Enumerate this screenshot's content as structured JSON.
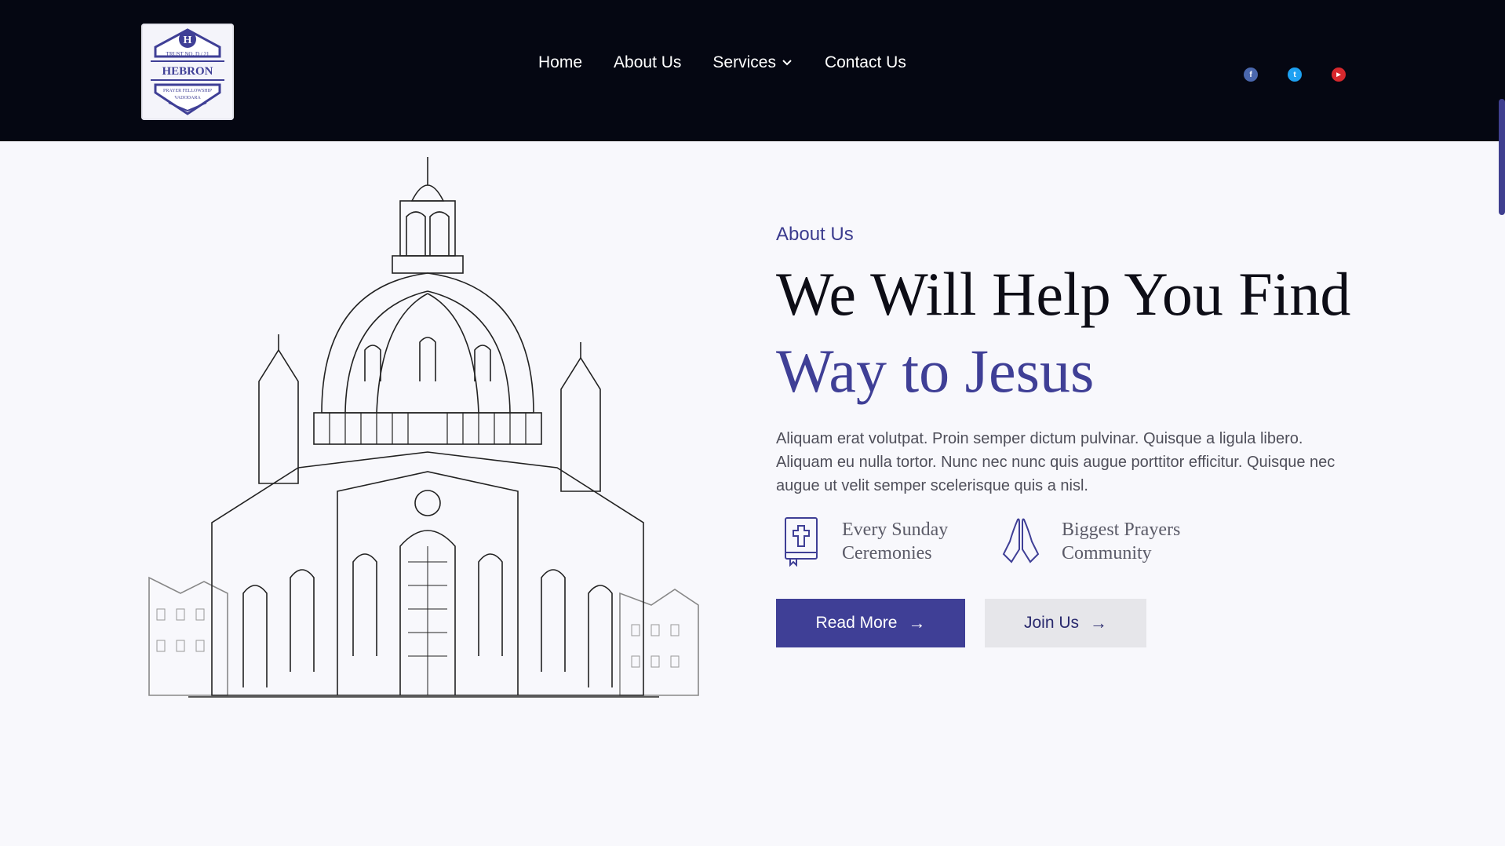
{
  "header": {
    "logo": {
      "letter": "H",
      "trust": "TRUST NO. D / 21",
      "name": "HEBRON",
      "tagline": "PRAYER FELLOWSHIP",
      "city": "VADODARA"
    },
    "nav": [
      {
        "label": "Home"
      },
      {
        "label": "About Us"
      },
      {
        "label": "Services",
        "has_dropdown": true
      },
      {
        "label": "Contact Us"
      }
    ],
    "social": [
      {
        "icon": "facebook-icon",
        "glyph": "f",
        "color": "#4a67ad"
      },
      {
        "icon": "twitter-icon",
        "glyph": "t",
        "color": "#1da1f2"
      },
      {
        "icon": "youtube-icon",
        "glyph": "▶",
        "color": "#d7282d"
      }
    ]
  },
  "about": {
    "eyebrow": "About Us",
    "headline_line1": "We Will Help You Find",
    "headline_line2": "Way to Jesus",
    "body": "Aliquam erat volutpat. Proin semper dictum pulvinar. Quisque a ligula libero. Aliquam eu nulla tortor. Nunc nec nunc quis augue porttitor efficitur. Quisque nec augue ut velit semper scelerisque quis a nisl.",
    "features": [
      {
        "icon": "bible-icon",
        "label": "Every Sunday Ceremonies"
      },
      {
        "icon": "praying-hands-icon",
        "label": "Biggest Prayers Community"
      }
    ],
    "buttons": {
      "primary": "Read More",
      "secondary": "Join Us"
    }
  },
  "colors": {
    "header_bg": "#050712",
    "accent": "#3f3f96",
    "page_bg": "#f8f8fc"
  }
}
